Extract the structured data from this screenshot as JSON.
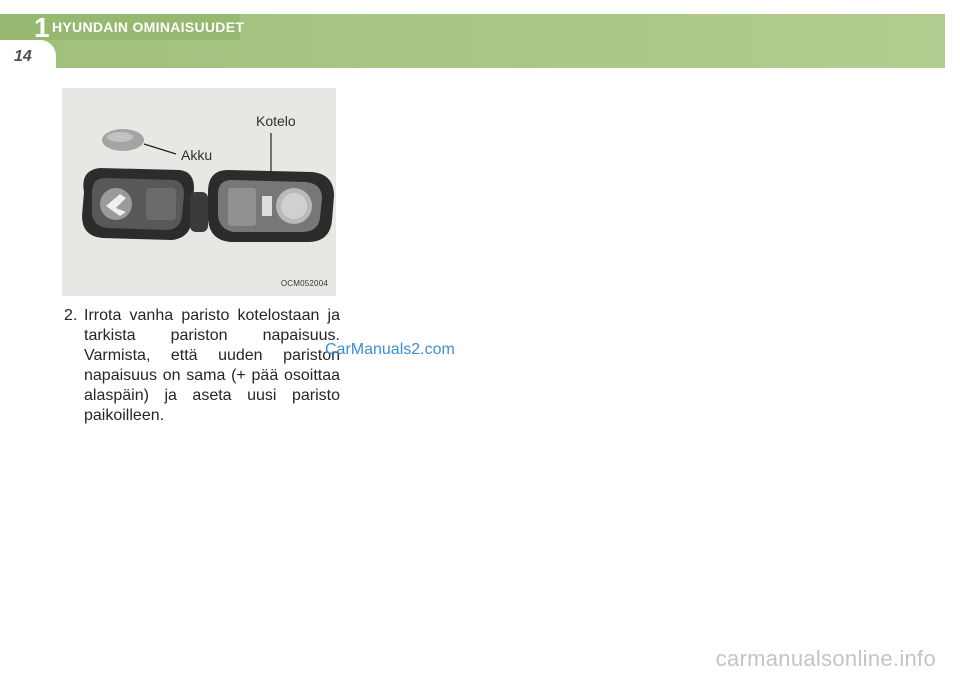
{
  "header": {
    "chapter_number": "1",
    "chapter_title": "HYUNDAIN OMINAISUUDET",
    "page_number": "14"
  },
  "figure": {
    "label_battery": "Akku",
    "label_case": "Kotelo",
    "figure_code": "OCM052004"
  },
  "instruction": {
    "number": "2.",
    "text": "Irrota vanha paristo kotelostaan ja tarkista pariston napaisuus. Varmista, että uuden pariston napaisuus on sama (+ pää osoittaa alaspäin) ja aseta uusi paristo paikoilleen."
  },
  "watermarks": {
    "top": "CarManuals2.com",
    "bottom": "carmanualsonline.info"
  },
  "colors": {
    "header_green": "#a7c583",
    "watermark_blue": "#3c8fd6"
  }
}
